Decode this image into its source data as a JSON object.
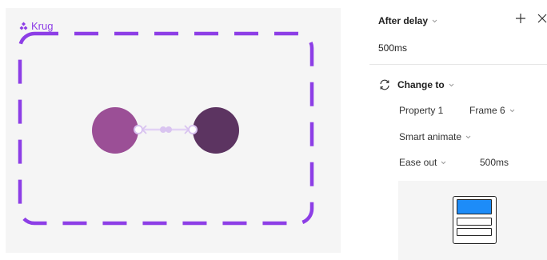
{
  "canvas": {
    "frame_name": "Krug",
    "accent_color": "#8d3ee6",
    "left_circle_color": "#9b4f96",
    "right_circle_color": "#5c3461",
    "connector_color": "#d9c4f0"
  },
  "panel": {
    "trigger_label": "After delay",
    "delay_value": "500ms",
    "add_icon": "plus-icon",
    "close_icon": "close-icon",
    "action_label": "Change to",
    "property_name": "Property 1",
    "property_value": "Frame 6",
    "animation_label": "Smart animate",
    "easing_label": "Ease out",
    "duration_value": "500ms",
    "preview_accent": "#1d8cf8"
  }
}
